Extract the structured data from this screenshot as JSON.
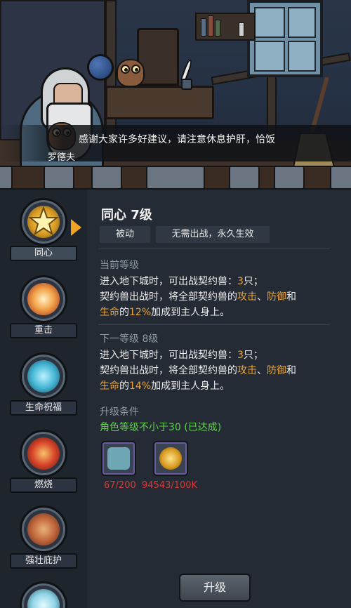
{
  "dialog": {
    "speaker": "罗德夫",
    "text": "感谢大家许多好建议，请注意休息护肝，恰饭"
  },
  "skills": [
    {
      "label": "同心",
      "icon": "sun-star-icon",
      "color": "#f2c63a"
    },
    {
      "label": "重击",
      "icon": "impact-burst-icon",
      "color": "#f3a34a"
    },
    {
      "label": "生命祝福",
      "icon": "water-drop-icon",
      "color": "#46b8d6"
    },
    {
      "label": "燃烧",
      "icon": "fire-swirl-icon",
      "color": "#d8452a"
    },
    {
      "label": "强壮庇护",
      "icon": "shield-icon",
      "color": "#c1673d"
    },
    {
      "label": "",
      "icon": "ice-spike-icon",
      "color": "#8fd4e6"
    }
  ],
  "detail": {
    "title": "同心 7级",
    "tag_type": "被动",
    "tag_desc": "无需出战，永久生效",
    "current": {
      "heading": "当前等级",
      "line1_prefix": "进入地下城时，可出战契约兽：",
      "line1_value": "3",
      "line1_suffix": "只；",
      "line2_prefix": "契约兽出战时，将全部契约兽的",
      "attack": "攻击",
      "sep": "、",
      "defense": "防御",
      "and": "和",
      "life": "生命",
      "of": "的",
      "percent": "12%",
      "line3_suffix": "加成到主人身上。"
    },
    "next": {
      "heading": "下一等级 8级",
      "line1_prefix": "进入地下城时，可出战契约兽：",
      "line1_value": "3",
      "line1_suffix": "只；",
      "line2_prefix": "契约兽出战时，将全部契约兽的",
      "attack": "攻击",
      "sep": "、",
      "defense": "防御",
      "and": "和",
      "life": "生命",
      "of": "的",
      "percent": "14%",
      "line3_suffix": "加成到主人身上。"
    },
    "upgrade": {
      "heading": "升级条件",
      "requirement": "角色等级不小于30 (已达成)",
      "items": [
        {
          "icon": "scroll-ticket-icon",
          "count": "67/200"
        },
        {
          "icon": "gold-coin-icon",
          "count": "94543/100K"
        }
      ],
      "button": "升级"
    }
  },
  "colors": {
    "highlight": "#e9a33a",
    "ok": "#62d04d",
    "insufficient": "#d63a3a",
    "selection": "#f0a425"
  }
}
